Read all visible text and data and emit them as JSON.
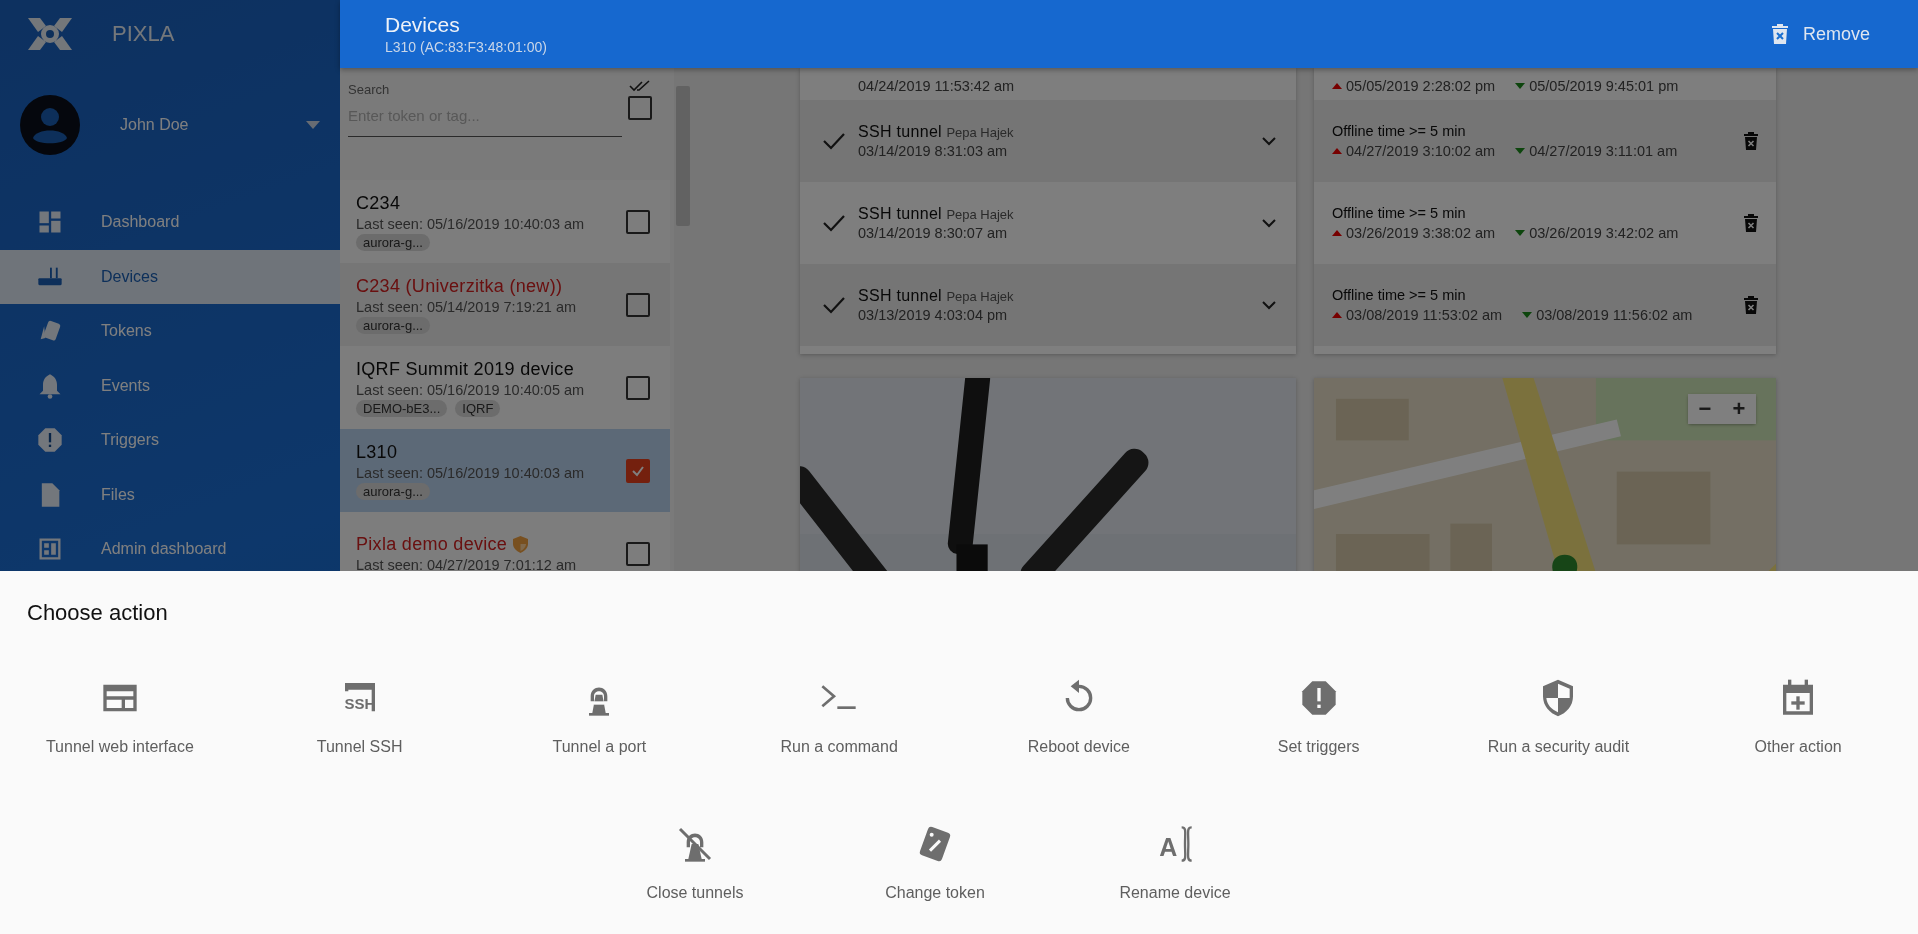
{
  "app": {
    "name": "PIXLA"
  },
  "user": {
    "name": "John Doe"
  },
  "nav": [
    {
      "label": "Dashboard",
      "kind": "dashboard",
      "selected": false
    },
    {
      "label": "Devices",
      "kind": "router",
      "selected": true
    },
    {
      "label": "Tokens",
      "kind": "tokens",
      "selected": false
    },
    {
      "label": "Events",
      "kind": "bell",
      "selected": false
    },
    {
      "label": "Triggers",
      "kind": "alert",
      "selected": false
    },
    {
      "label": "Files",
      "kind": "file",
      "selected": false
    },
    {
      "label": "Admin dashboard",
      "kind": "admin",
      "selected": false
    }
  ],
  "header": {
    "title": "Devices",
    "subtitle": "L310 (AC:83:F3:48:01:00)",
    "action": "Remove"
  },
  "device_list": {
    "search_label": "Search",
    "placeholder": "Enter token or tag...",
    "select_all_checked": false,
    "items": [
      {
        "name": "C234",
        "alert": false,
        "shield": false,
        "last_seen": "Last seen: 05/16/2019 10:40:03 am",
        "tags": [
          "aurora-g..."
        ],
        "checked": false,
        "selected": false
      },
      {
        "name": "C234 (Univerzitka (new))",
        "alert": true,
        "shield": false,
        "last_seen": "Last seen: 05/14/2019 7:19:21 am",
        "tags": [
          "aurora-g..."
        ],
        "checked": false,
        "selected": false
      },
      {
        "name": "IQRF Summit 2019 device",
        "alert": false,
        "shield": false,
        "last_seen": "Last seen: 05/16/2019 10:40:05 am",
        "tags": [
          "DEMO-bE3...",
          "IQRF"
        ],
        "checked": false,
        "selected": false
      },
      {
        "name": "L310",
        "alert": false,
        "shield": false,
        "last_seen": "Last seen: 05/16/2019 10:40:03 am",
        "tags": [
          "aurora-g..."
        ],
        "checked": true,
        "selected": true
      },
      {
        "name": "Pixla demo device",
        "alert": true,
        "shield": true,
        "last_seen": "Last seen: 04/27/2019 7:01:12 am",
        "checked": false,
        "selected": false
      }
    ]
  },
  "history": [
    {
      "kind": "partial",
      "time": "04/24/2019 11:53:42 am"
    },
    {
      "kind": "full",
      "title": "SSH tunnel",
      "user": "Pepa Hajek",
      "time": "03/14/2019 8:31:03 am"
    },
    {
      "kind": "full",
      "title": "SSH tunnel",
      "user": "Pepa Hajek",
      "time": "03/14/2019 8:30:07 am"
    },
    {
      "kind": "full",
      "title": "SSH tunnel",
      "user": "Pepa Hajek",
      "time": "03/13/2019 4:03:04 pm"
    }
  ],
  "triggers": [
    {
      "kind": "partial",
      "up": "05/05/2019 2:28:02 pm",
      "down": "05/05/2019 9:45:01 pm"
    },
    {
      "kind": "full",
      "condition": "Offline time >= 5 min",
      "up": "04/27/2019 3:10:02 am",
      "down": "04/27/2019 3:11:01 am"
    },
    {
      "kind": "full",
      "condition": "Offline time >= 5 min",
      "up": "03/26/2019 3:38:02 am",
      "down": "03/26/2019 3:42:02 am"
    },
    {
      "kind": "full",
      "condition": "Offline time >= 5 min",
      "up": "03/08/2019 11:53:02 am",
      "down": "03/08/2019 11:56:02 am"
    }
  ],
  "map": {
    "zoom_out": "−",
    "zoom_in": "+"
  },
  "sheet": {
    "title": "Choose action",
    "rows": [
      {
        "actions": [
          {
            "label": "Tunnel web interface",
            "kind": "web"
          },
          {
            "label": "Tunnel SSH",
            "kind": "ssh",
            "icon_text": "SSH"
          },
          {
            "label": "Tunnel a port",
            "kind": "port"
          },
          {
            "label": "Run a command",
            "kind": "terminal"
          },
          {
            "label": "Reboot device",
            "kind": "reboot"
          },
          {
            "label": "Set triggers",
            "kind": "triggers"
          },
          {
            "label": "Run a security audit",
            "kind": "shield"
          },
          {
            "label": "Other action",
            "kind": "calendar"
          }
        ]
      },
      {
        "actions": [
          {
            "label": "Close tunnels",
            "kind": "close-tunnels"
          },
          {
            "label": "Change token",
            "kind": "token"
          },
          {
            "label": "Rename device",
            "kind": "rename",
            "icon_text": "A"
          }
        ]
      }
    ]
  }
}
